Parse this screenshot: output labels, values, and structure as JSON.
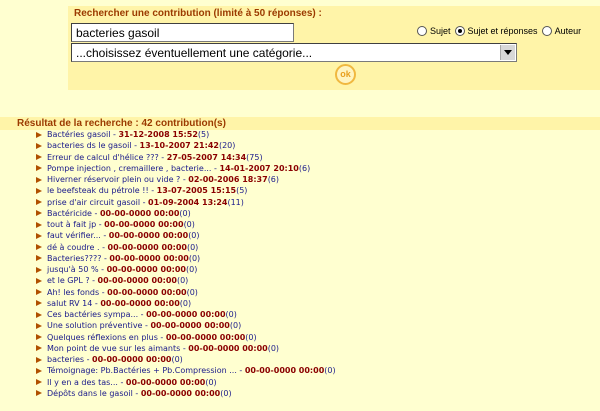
{
  "search": {
    "title": "Rechercher une contribution (limité à 50 réponses) :",
    "query": "bacteries gasoil",
    "radios": [
      {
        "label": "Sujet",
        "checked": false
      },
      {
        "label": "Sujet et réponses",
        "checked": true
      },
      {
        "label": "Auteur",
        "checked": false
      }
    ],
    "category": "...choisissez éventuellement une catégorie...",
    "ok_label": "ok"
  },
  "results": {
    "title": "Résultat de la recherche : 42 contribution(s)",
    "items": [
      {
        "title": "Bactéries gasoil",
        "date": "31-12-2008 15:52",
        "count": "(5)"
      },
      {
        "title": "bacteries ds le gasoil",
        "date": "13-10-2007 21:42",
        "count": "(20)"
      },
      {
        "title": "Erreur de calcul d'hélice ???",
        "date": "27-05-2007 14:34",
        "count": "(75)"
      },
      {
        "title": "Pompe injection , cremaillere , bacterie...",
        "date": "14-01-2007 20:10",
        "count": "(6)"
      },
      {
        "title": "Hiverner réservoir plein ou vide ?",
        "date": "02-00-2006 18:37",
        "count": "(6)"
      },
      {
        "title": "le beefsteak du pétrole !!",
        "date": "13-07-2005 15:15",
        "count": "(5)"
      },
      {
        "title": "prise d'air circuit gasoil",
        "date": "01-09-2004 13:24",
        "count": "(11)"
      },
      {
        "title": "Bactéricide",
        "date": "00-00-0000 00:00",
        "count": "(0)"
      },
      {
        "title": "tout à fait jp",
        "date": "00-00-0000 00:00",
        "count": "(0)"
      },
      {
        "title": "faut vérifier...",
        "date": "00-00-0000 00:00",
        "count": "(0)"
      },
      {
        "title": "dé à coudre .",
        "date": "00-00-0000 00:00",
        "count": "(0)"
      },
      {
        "title": "Bacteries????",
        "date": "00-00-0000 00:00",
        "count": "(0)"
      },
      {
        "title": "jusqu'à 50 %",
        "date": "00-00-0000 00:00",
        "count": "(0)"
      },
      {
        "title": "et le GPL ?",
        "date": "00-00-0000 00:00",
        "count": "(0)"
      },
      {
        "title": "Ah! les fonds",
        "date": "00-00-0000 00:00",
        "count": "(0)"
      },
      {
        "title": "salut RV 14",
        "date": "00-00-0000 00:00",
        "count": "(0)"
      },
      {
        "title": "Ces bactéries sympa...",
        "date": "00-00-0000 00:00",
        "count": "(0)"
      },
      {
        "title": "Une solution préventive",
        "date": "00-00-0000 00:00",
        "count": "(0)"
      },
      {
        "title": "Quelques réflexions en plus",
        "date": "00-00-0000 00:00",
        "count": "(0)"
      },
      {
        "title": "Mon point de vue sur les aimants",
        "date": "00-00-0000 00:00",
        "count": "(0)"
      },
      {
        "title": "bacteries",
        "date": "00-00-0000 00:00",
        "count": "(0)"
      },
      {
        "title": "Témoignage: Pb.Bactéries + Pb.Compression ...",
        "date": "00-00-0000 00:00",
        "count": "(0)"
      },
      {
        "title": "Il y en a des tas...",
        "date": "00-00-0000 00:00",
        "count": "(0)"
      },
      {
        "title": "Dépôts dans le gasoil",
        "date": "00-00-0000 00:00",
        "count": "(0)"
      }
    ]
  }
}
